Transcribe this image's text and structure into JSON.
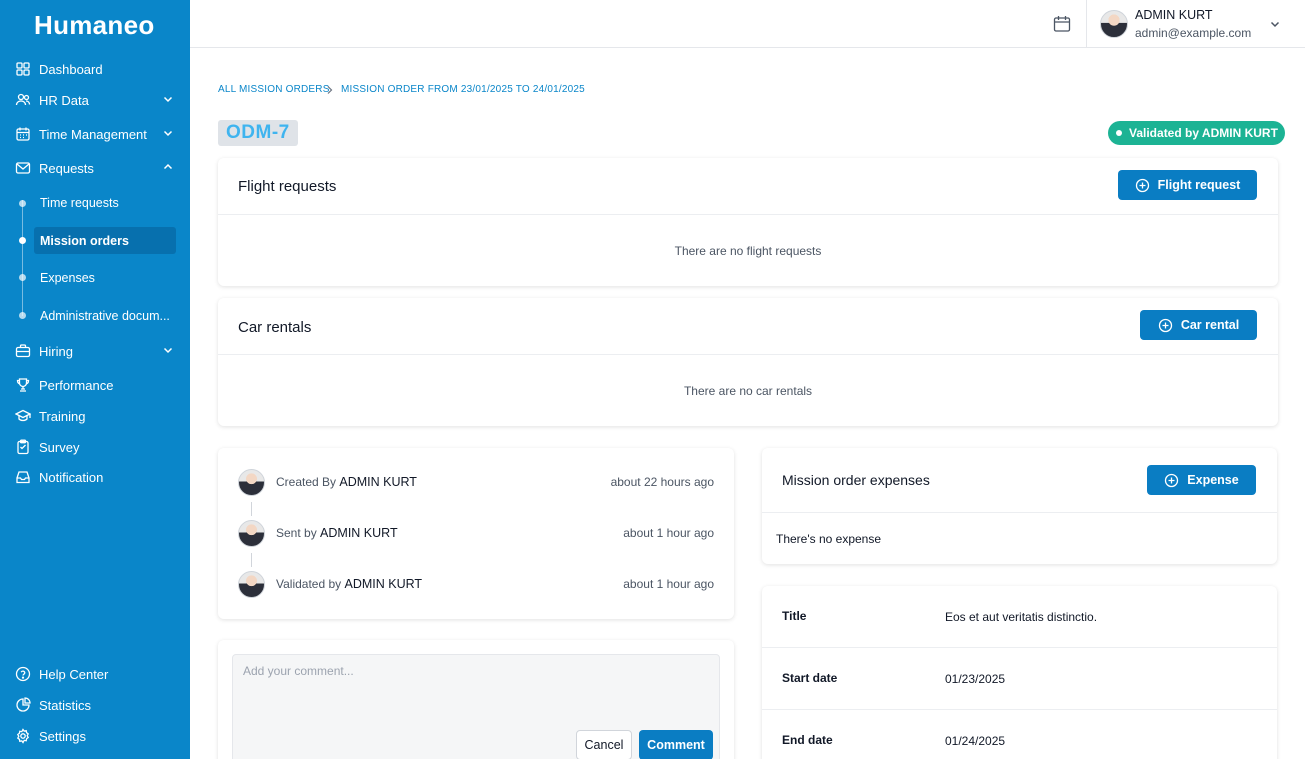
{
  "sidebar": {
    "brand": "Humaneo",
    "items": [
      {
        "label": "Dashboard",
        "icon": "grid-icon"
      },
      {
        "label": "HR Data",
        "icon": "users-icon"
      },
      {
        "label": "Time Management",
        "icon": "calendar-icon"
      },
      {
        "label": "Requests",
        "icon": "mail-icon"
      },
      {
        "label": "Hiring",
        "icon": "briefcase-icon"
      },
      {
        "label": "Performance",
        "icon": "trophy-icon"
      },
      {
        "label": "Training",
        "icon": "graduation-cap-icon"
      },
      {
        "label": "Survey",
        "icon": "clipboard-icon"
      },
      {
        "label": "Notification",
        "icon": "inbox-icon"
      }
    ],
    "requests_sub": [
      {
        "label": "Time requests"
      },
      {
        "label": "Mission orders",
        "active": true
      },
      {
        "label": "Expenses"
      },
      {
        "label": "Administrative docum..."
      }
    ],
    "bottom": [
      {
        "label": "Help Center",
        "icon": "help-circle-icon"
      },
      {
        "label": "Statistics",
        "icon": "pie-chart-icon"
      },
      {
        "label": "Settings",
        "icon": "gear-icon"
      }
    ]
  },
  "topbar": {
    "user_name": "ADMIN KURT",
    "user_email": "admin@example.com"
  },
  "breadcrumb": {
    "root": "ALL MISSION ORDERS",
    "current": "MISSION ORDER FROM 23/01/2025 TO 24/01/2025"
  },
  "order": {
    "code": "ODM-7",
    "status": "Validated by ADMIN KURT",
    "status_color": "#1cb394"
  },
  "flight_requests": {
    "title": "Flight requests",
    "button": "Flight request",
    "empty": "There are no flight requests"
  },
  "car_rentals": {
    "title": "Car rentals",
    "button": "Car rental",
    "empty": "There are no car rentals"
  },
  "timeline": [
    {
      "action": "Created By",
      "user": "ADMIN KURT",
      "time": "about 22 hours ago"
    },
    {
      "action": "Sent by",
      "user": "ADMIN KURT",
      "time": "about 1 hour ago"
    },
    {
      "action": "Validated by",
      "user": "ADMIN KURT",
      "time": "about 1 hour ago"
    }
  ],
  "comment": {
    "placeholder": "Add your comment...",
    "cancel": "Cancel",
    "submit": "Comment"
  },
  "expenses": {
    "title": "Mission order expenses",
    "button": "Expense",
    "empty": "There's no expense"
  },
  "details": [
    {
      "key": "Title",
      "value": "Eos et aut veritatis distinctio."
    },
    {
      "key": "Start date",
      "value": "01/23/2025"
    },
    {
      "key": "End date",
      "value": "01/24/2025"
    }
  ],
  "colors": {
    "sidebar": "#0a86c9",
    "primary_button": "#0a7dc3",
    "accent_text": "#0a86c9"
  }
}
